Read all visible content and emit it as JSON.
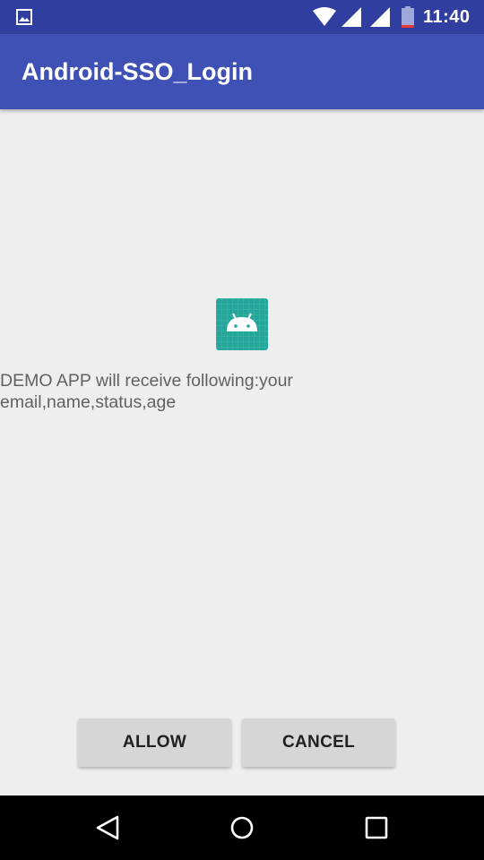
{
  "status_bar": {
    "time": "11:40",
    "icons": [
      "gallery-icon",
      "wifi-icon",
      "signal-icon",
      "signal-icon",
      "battery-icon"
    ],
    "background_color": "#303f9f"
  },
  "app_bar": {
    "title": "Android-SSO_Login",
    "background_color": "#3f51b5"
  },
  "content": {
    "app_icon": "android-app-icon",
    "message": "DEMO APP will receive following:your email,name,status,age"
  },
  "buttons": {
    "allow_label": "ALLOW",
    "cancel_label": "CANCEL"
  },
  "nav_bar": {
    "icons": [
      "back-icon",
      "home-icon",
      "recents-icon"
    ]
  },
  "colors": {
    "accent_teal": "#26a69a",
    "background": "#eeeeee"
  }
}
